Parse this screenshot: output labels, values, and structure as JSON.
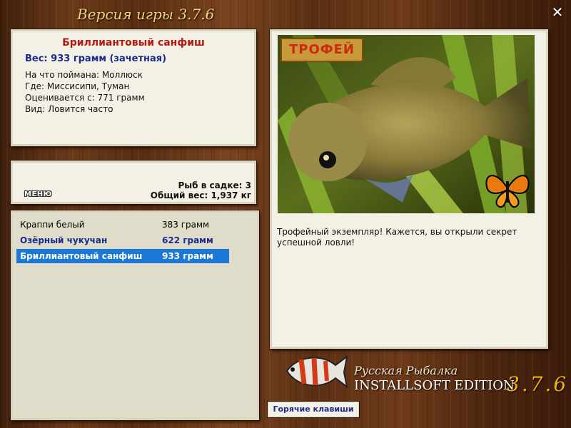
{
  "window": {
    "title": "Версия игры 3.7.6"
  },
  "fish_info": {
    "name": "Бриллиантовый санфиш",
    "weight": "Вес: 933 грамм (зачетная)",
    "lines": [
      "На что поймана: Моллюск",
      "Где: Миссисипи, Туман",
      "Оценивается с: 771 грамм",
      "Вид: Ловится часто"
    ]
  },
  "stats": {
    "menu_label": "МЕНЮ",
    "fish_count": "Рыб в садке: 3",
    "total_weight": "Общий вес: 1,937 кг"
  },
  "catch_list": [
    {
      "name": "Краппи белый",
      "weight": "383 грамм"
    },
    {
      "name": "Озёрный чукучан",
      "weight": "622 грамм"
    },
    {
      "name": "Бриллиантовый санфиш",
      "weight": "933 грамм"
    }
  ],
  "photo": {
    "badge": "ТРОФЕЙ",
    "message": "Трофейный экземпляр! Кажется, вы открыли секрет успешной ловли!"
  },
  "logo": {
    "line1": "Русская Рыбалка",
    "line2": "INSTALLSOFT EDITION",
    "version": "3.7.6"
  },
  "hotkeys_label": "Горячие клавиши",
  "colors": {
    "accent_selected": "#1a78d6",
    "fish_name": "#b51a10",
    "weight_text": "#1b2a8c",
    "title_text": "#f3d27a",
    "version_text": "#f5b20a"
  },
  "icons": [
    "close-icon",
    "fish-logo-icon",
    "butterfly-icon"
  ]
}
